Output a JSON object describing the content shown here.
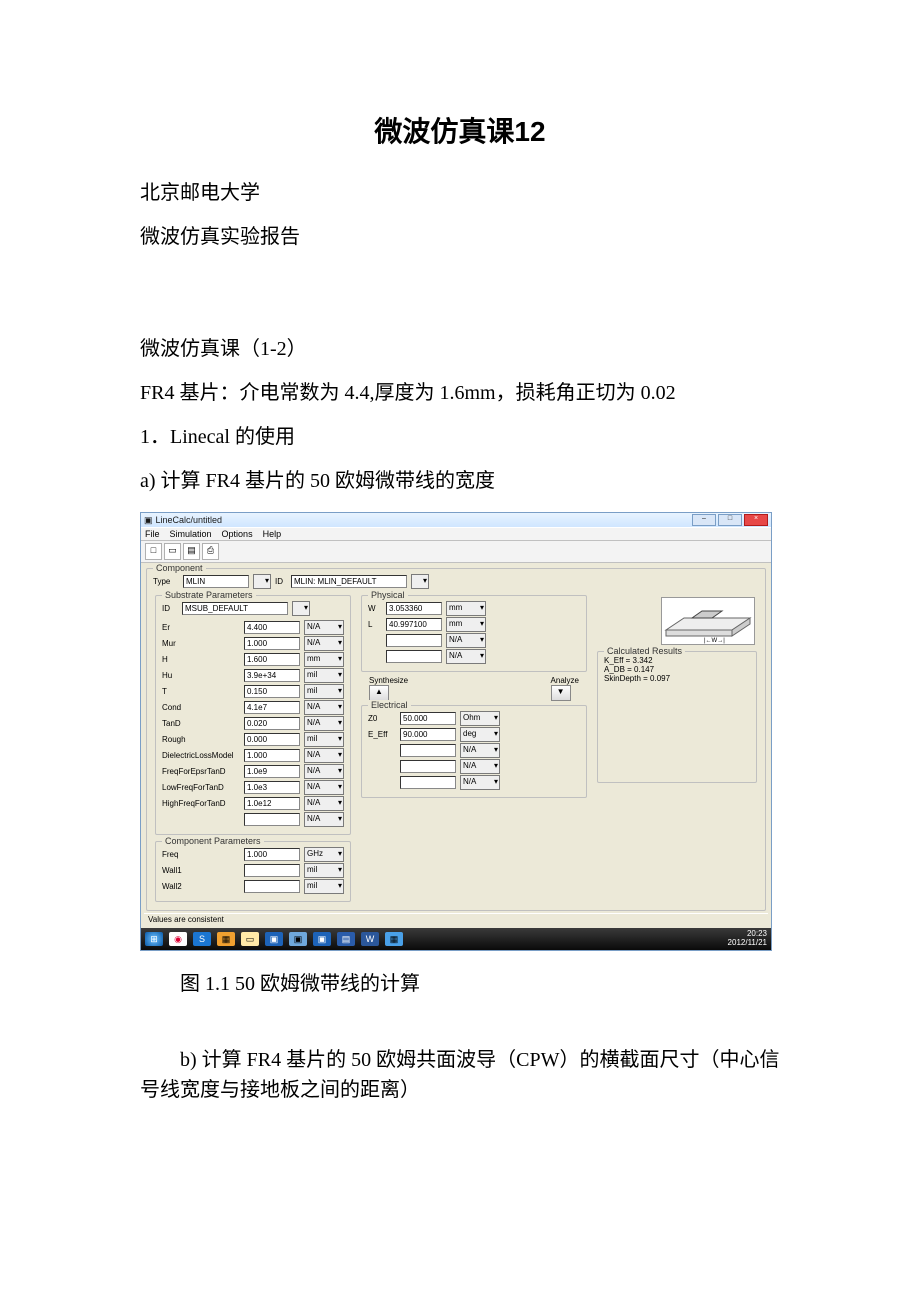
{
  "page": {
    "title": "微波仿真课12",
    "line1": "北京邮电大学",
    "line2": "微波仿真实验报告",
    "line3": "微波仿真课（1-2）",
    "line4": "FR4 基片：介电常数为 4.4,厚度为 1.6mm，损耗角正切为 0.02",
    "line5": "1．Linecal 的使用",
    "line6": "a) 计算 FR4 基片的 50 欧姆微带线的宽度",
    "figcap": "图 1.1 50 欧姆微带线的计算",
    "line7": "b) 计算 FR4 基片的 50 欧姆共面波导（CPW）的横截面尺寸（中心信号线宽度与接地板之间的距离）"
  },
  "shot": {
    "title": "LineCalc/untitled",
    "menu": {
      "file": "File",
      "simulation": "Simulation",
      "options": "Options",
      "help": "Help"
    },
    "toolbar": {
      "new": "□",
      "open": "▭",
      "save": "▤",
      "print": "⎙"
    },
    "component": {
      "legend": "Component",
      "type_label": "Type",
      "type_value": "MLIN",
      "id_label": "ID",
      "id_value": "MLIN: MLIN_DEFAULT"
    },
    "substrate": {
      "legend": "Substrate Parameters",
      "id_label": "ID",
      "id_value": "MSUB_DEFAULT",
      "rows": [
        {
          "name": "Er",
          "val": "4.400",
          "unit": "N/A"
        },
        {
          "name": "Mur",
          "val": "1.000",
          "unit": "N/A"
        },
        {
          "name": "H",
          "val": "1.600",
          "unit": "mm"
        },
        {
          "name": "Hu",
          "val": "3.9e+34",
          "unit": "mil"
        },
        {
          "name": "T",
          "val": "0.150",
          "unit": "mil"
        },
        {
          "name": "Cond",
          "val": "4.1e7",
          "unit": "N/A"
        },
        {
          "name": "TanD",
          "val": "0.020",
          "unit": "N/A"
        },
        {
          "name": "Rough",
          "val": "0.000",
          "unit": "mil"
        },
        {
          "name": "DielectricLossModel",
          "val": "1.000",
          "unit": "N/A"
        },
        {
          "name": "FreqForEpsrTanD",
          "val": "1.0e9",
          "unit": "N/A"
        },
        {
          "name": "LowFreqForTanD",
          "val": "1.0e3",
          "unit": "N/A"
        },
        {
          "name": "HighFreqForTanD",
          "val": "1.0e12",
          "unit": "N/A"
        },
        {
          "name": "",
          "val": "",
          "unit": "N/A"
        }
      ]
    },
    "comp_params": {
      "legend": "Component Parameters",
      "rows": [
        {
          "name": "Freq",
          "val": "1.000",
          "unit": "GHz"
        },
        {
          "name": "Wall1",
          "val": "",
          "unit": "mil"
        },
        {
          "name": "Wall2",
          "val": "",
          "unit": "mil"
        }
      ]
    },
    "physical": {
      "legend": "Physical",
      "rows": [
        {
          "name": "W",
          "val": "3.053360",
          "unit": "mm"
        },
        {
          "name": "L",
          "val": "40.997100",
          "unit": "mm"
        },
        {
          "name": "",
          "val": "",
          "unit": "N/A"
        },
        {
          "name": "",
          "val": "",
          "unit": "N/A"
        }
      ]
    },
    "syn": {
      "synth": "Synthesize",
      "anal": "Analyze",
      "up": "▲",
      "down": "▼"
    },
    "electrical": {
      "legend": "Electrical",
      "rows": [
        {
          "name": "Z0",
          "val": "50.000",
          "unit": "Ohm"
        },
        {
          "name": "E_Eff",
          "val": "90.000",
          "unit": "deg"
        },
        {
          "name": "",
          "val": "",
          "unit": "N/A"
        },
        {
          "name": "",
          "val": "",
          "unit": "N/A"
        },
        {
          "name": "",
          "val": "",
          "unit": "N/A"
        }
      ]
    },
    "results": {
      "legend": "Calculated Results",
      "lines": [
        "K_Eff = 3.342",
        "A_DB = 0.147",
        "SkinDepth = 0.097"
      ]
    },
    "status": "Values are consistent",
    "time": "20:23",
    "date": "2012/11/21"
  }
}
